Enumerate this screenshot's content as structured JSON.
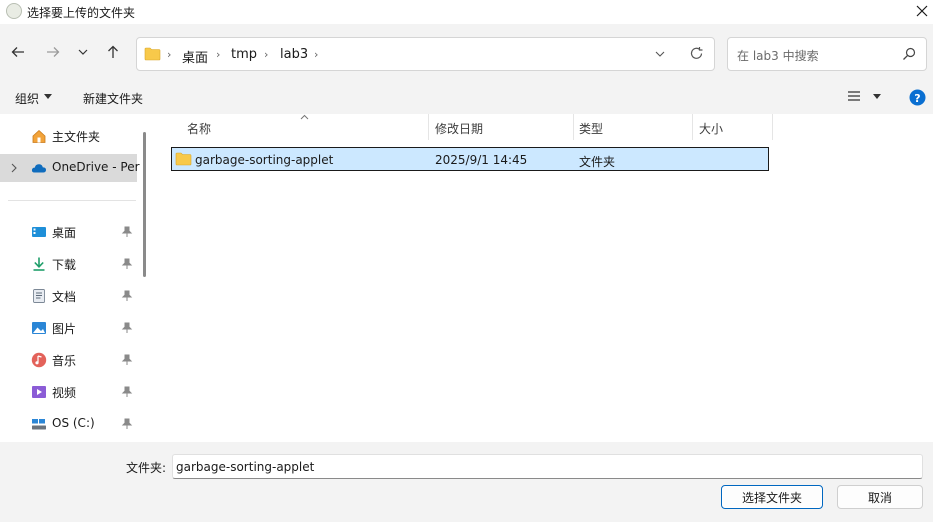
{
  "window": {
    "title": "选择要上传的文件夹"
  },
  "address": {
    "crumbs": [
      "桌面",
      "tmp",
      "lab3"
    ]
  },
  "search": {
    "placeholder": "在 lab3 中搜索"
  },
  "commands": {
    "organize": "组织",
    "new_folder": "新建文件夹"
  },
  "sidebar": {
    "items": [
      {
        "label": "主文件夹",
        "icon": "home-icon"
      },
      {
        "label": "OneDrive - Per",
        "icon": "onedrive-icon"
      },
      {
        "label": "桌面",
        "icon": "desktop-icon"
      },
      {
        "label": "下载",
        "icon": "download-icon"
      },
      {
        "label": "文档",
        "icon": "document-icon"
      },
      {
        "label": "图片",
        "icon": "pictures-icon"
      },
      {
        "label": "音乐",
        "icon": "music-icon"
      },
      {
        "label": "视频",
        "icon": "video-icon"
      },
      {
        "label": "OS (C:)",
        "icon": "drive-icon"
      }
    ]
  },
  "columns": {
    "name": "名称",
    "modified": "修改日期",
    "type": "类型",
    "size": "大小"
  },
  "files": [
    {
      "name": "garbage-sorting-applet",
      "modified": "2025/9/1 14:45",
      "type": "文件夹",
      "size": ""
    }
  ],
  "footer": {
    "folder_label": "文件夹:",
    "folder_value": "garbage-sorting-applet",
    "select_label": "选择文件夹",
    "cancel_label": "取消"
  },
  "colors": {
    "accent": "#0067c0",
    "selection": "#cce8ff",
    "folder": "#f8c94a",
    "help": "#0a6fd1"
  }
}
